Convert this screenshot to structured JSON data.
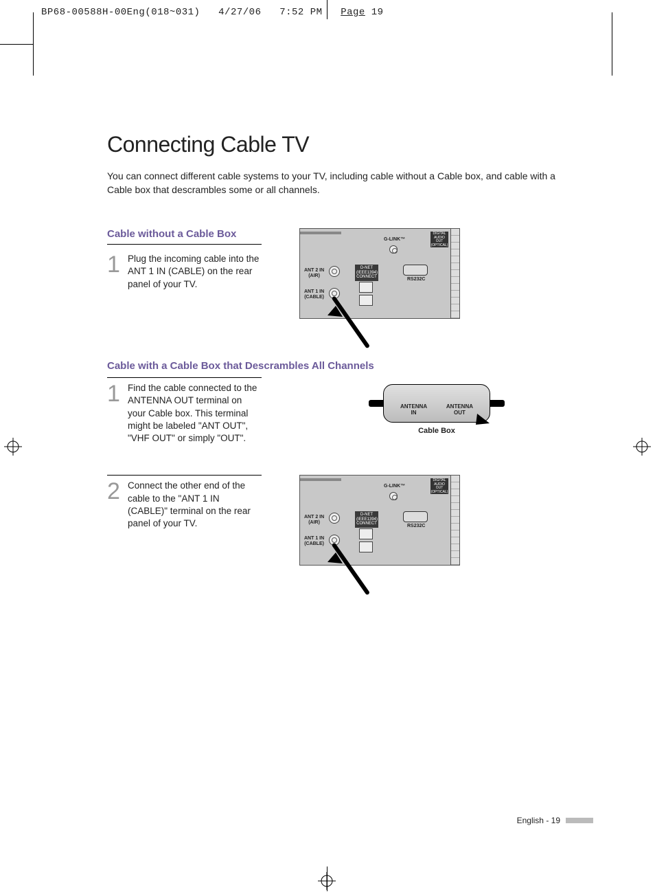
{
  "header": {
    "filecode": "BP68-00588H-00Eng(018~031)",
    "date": "4/27/06",
    "time": "7:52 PM",
    "page_label": "Page",
    "page_num": "19"
  },
  "title": "Connecting Cable TV",
  "intro": "You can connect different cable systems to your TV, including cable without a Cable box, and cable with a Cable box that descrambles some or all channels.",
  "section1": {
    "heading": "Cable without a Cable Box",
    "step1_num": "1",
    "step1_text": "Plug the incoming cable into the ANT 1 IN (CABLE) on the rear panel of your TV."
  },
  "section2": {
    "heading": "Cable with a Cable Box that Descrambles All Channels",
    "step1_num": "1",
    "step1_text": "Find the cable connected to the ANTENNA OUT terminal on your Cable box. This terminal might be labeled \"ANT OUT\", \"VHF OUT\" or simply \"OUT\".",
    "step2_num": "2",
    "step2_text": "Connect the other end of the cable to the \"ANT 1 IN (CABLE)\" terminal on the rear panel of your TV.",
    "cablebox_left": "ANTENNA\nIN",
    "cablebox_right": "ANTENNA\nOUT",
    "cablebox_caption": "Cable Box"
  },
  "tv_panel": {
    "ant2": "ANT 2 IN\n(AIR)",
    "ant1": "ANT 1 IN\n(CABLE)",
    "dnet": "D-NET\n(IEEE1394)\nCONNECT",
    "glink": "G-LINK™",
    "rs232": "RS232C",
    "optical": "DIGITAL\nAUDIO OUT\n(OPTICAL)"
  },
  "footer": {
    "text": "English - 19"
  }
}
